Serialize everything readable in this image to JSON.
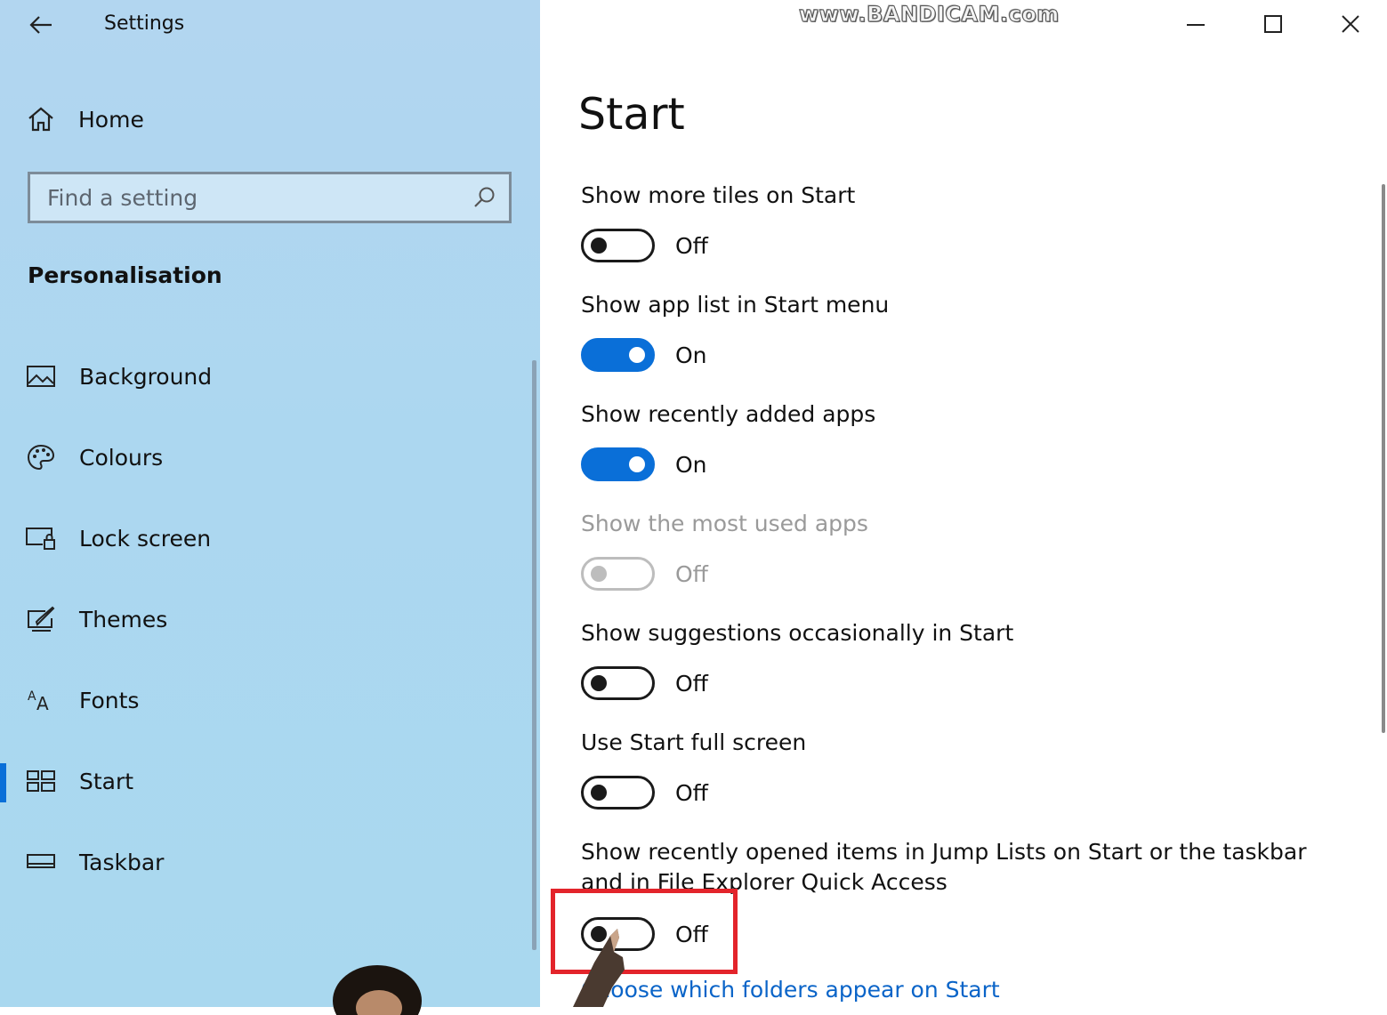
{
  "window": {
    "title": "Settings",
    "watermark": "www.BANDICAM.com"
  },
  "sidebar": {
    "home_label": "Home",
    "search_placeholder": "Find a setting",
    "section_title": "Personalisation",
    "items": [
      {
        "label": "Background",
        "icon": "picture-icon"
      },
      {
        "label": "Colours",
        "icon": "palette-icon"
      },
      {
        "label": "Lock screen",
        "icon": "lock-screen-icon"
      },
      {
        "label": "Themes",
        "icon": "brush-icon"
      },
      {
        "label": "Fonts",
        "icon": "font-icon"
      },
      {
        "label": "Start",
        "icon": "start-tiles-icon",
        "selected": true
      },
      {
        "label": "Taskbar",
        "icon": "taskbar-icon"
      }
    ]
  },
  "main": {
    "page_title": "Start",
    "settings": [
      {
        "label": "Show more tiles on Start",
        "state": "Off",
        "on": false,
        "enabled": true
      },
      {
        "label": "Show app list in Start menu",
        "state": "On",
        "on": true,
        "enabled": true
      },
      {
        "label": "Show recently added apps",
        "state": "On",
        "on": true,
        "enabled": true
      },
      {
        "label": "Show the most used apps",
        "state": "Off",
        "on": false,
        "enabled": false
      },
      {
        "label": "Show suggestions occasionally in Start",
        "state": "Off",
        "on": false,
        "enabled": true
      },
      {
        "label": "Use Start full screen",
        "state": "Off",
        "on": false,
        "enabled": true
      },
      {
        "label": "Show recently opened items in Jump Lists on Start or the taskbar and in File Explorer Quick Access",
        "state": "Off",
        "on": false,
        "enabled": true
      }
    ],
    "link": "Choose which folders appear on Start"
  },
  "colors": {
    "accent": "#0a6fd8",
    "sidebar_bg": "#acd7f0",
    "highlight_box": "#e3242b",
    "link": "#0a64c8"
  }
}
